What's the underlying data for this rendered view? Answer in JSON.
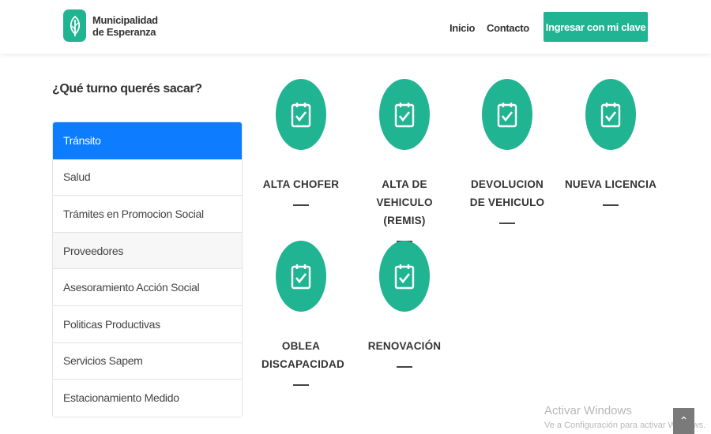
{
  "header": {
    "logo_line1": "Municipalidad",
    "logo_line2": "de Esperanza",
    "nav": {
      "inicio": "Inicio",
      "contacto": "Contacto"
    },
    "login_label": "Ingresar con mi clave"
  },
  "sidebar": {
    "question": "¿Qué turno querés sacar?",
    "items": [
      "Tránsito",
      "Salud",
      "Trámites en Promocion Social",
      "Proveedores",
      "Asesoramiento Acción Social",
      "Politicas Productivas",
      "Servicios Sapem",
      "Estacionamiento Medido"
    ],
    "active_index": 0
  },
  "cards": [
    {
      "label": "ALTA CHOFER",
      "icon": "calendar-check-icon"
    },
    {
      "label": "ALTA DE VEHICULO (REMIS)",
      "icon": "calendar-check-icon"
    },
    {
      "label": "DEVOLUCION DE VEHICULO",
      "icon": "calendar-check-icon"
    },
    {
      "label": "NUEVA LICENCIA",
      "icon": "calendar-check-icon"
    },
    {
      "label": "OBLEA DISCAPACIDAD",
      "icon": "calendar-check-icon"
    },
    {
      "label": "RENOVACIÓN",
      "icon": "calendar-check-icon"
    }
  ],
  "watermark": {
    "title": "Activar Windows",
    "subtitle": "Ve a Configuración para activar Windows."
  },
  "colors": {
    "accent": "#20b493",
    "active": "#0d7cff"
  }
}
